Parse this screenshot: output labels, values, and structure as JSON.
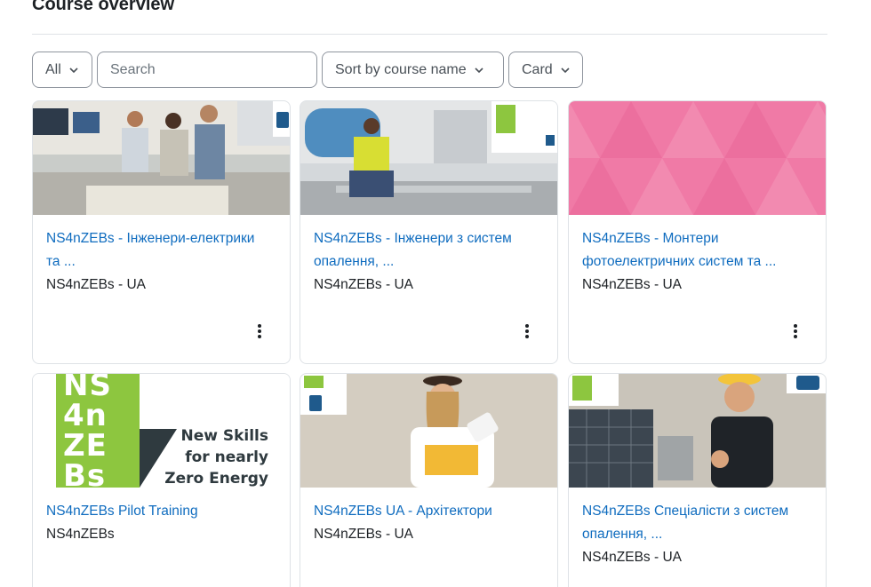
{
  "page": {
    "heading": "Course overview"
  },
  "filters": {
    "grouping": "All",
    "search_placeholder": "Search",
    "sort": "Sort by course name",
    "view": "Card"
  },
  "courses": [
    {
      "title_line1": "NS4nZEBs - Інженери-електрики",
      "title_line2": "та ...",
      "category": "NS4nZEBs - UA",
      "image": "engineers-office-photo"
    },
    {
      "title_line1": "NS4nZEBs - Інженери з систем",
      "title_line2": "опалення, ...",
      "category": "NS4nZEBs - UA",
      "image": "technician-pipes-photo"
    },
    {
      "title_line1": "NS4nZEBs - Монтери",
      "title_line2": "фотоелектричних систем та ...",
      "category": "NS4nZEBs - UA",
      "image": "pink-triangle-pattern"
    },
    {
      "title_line1": "NS4nZEBs Pilot Training",
      "title_line2": "",
      "category": "NS4nZEBs",
      "image": "ns4nzebs-logo-banner"
    },
    {
      "title_line1": "NS4nZEBs UA - Архітектори",
      "title_line2": "",
      "category": "NS4nZEBs - UA",
      "image": "architect-photo"
    },
    {
      "title_line1": "NS4nZEBs Спеціалісти з систем",
      "title_line2": "опалення, ...",
      "category": "NS4nZEBs - UA",
      "image": "solar-worker-photo"
    }
  ],
  "banner": {
    "logo_letters": [
      "NS",
      "4n",
      "ZE",
      "Bs"
    ],
    "tagline_1": "New Skills",
    "tagline_2": "for nearly",
    "tagline_3": "Zero Energy"
  },
  "colors": {
    "link": "#0f6cbf",
    "brand_green": "#8dc63f",
    "pink": "#f07aa6"
  }
}
